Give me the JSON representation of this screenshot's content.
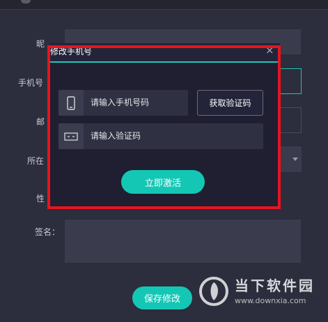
{
  "form": {
    "nickname_label": "昵",
    "phone_label": "手机号",
    "email_label": "邮",
    "location_label": "所在",
    "gender_label": "性",
    "signature_label": "签名：",
    "save_button": "保存修改"
  },
  "modal": {
    "title": "修改手机号",
    "close_symbol": "×",
    "phone_placeholder": "请输入手机号码",
    "code_placeholder": "请输入验证码",
    "get_code_button": "获取验证码",
    "activate_button": "立即激活"
  },
  "colors": {
    "accent": "#14c7b5",
    "highlight_frame": "#e8141e",
    "modal_bg": "#1f1f31",
    "page_bg": "#2c2d3d"
  },
  "watermark": {
    "brand": "当下软件园",
    "url": "www.downxia.com",
    "logo_icon": "downxia-logo-icon"
  }
}
